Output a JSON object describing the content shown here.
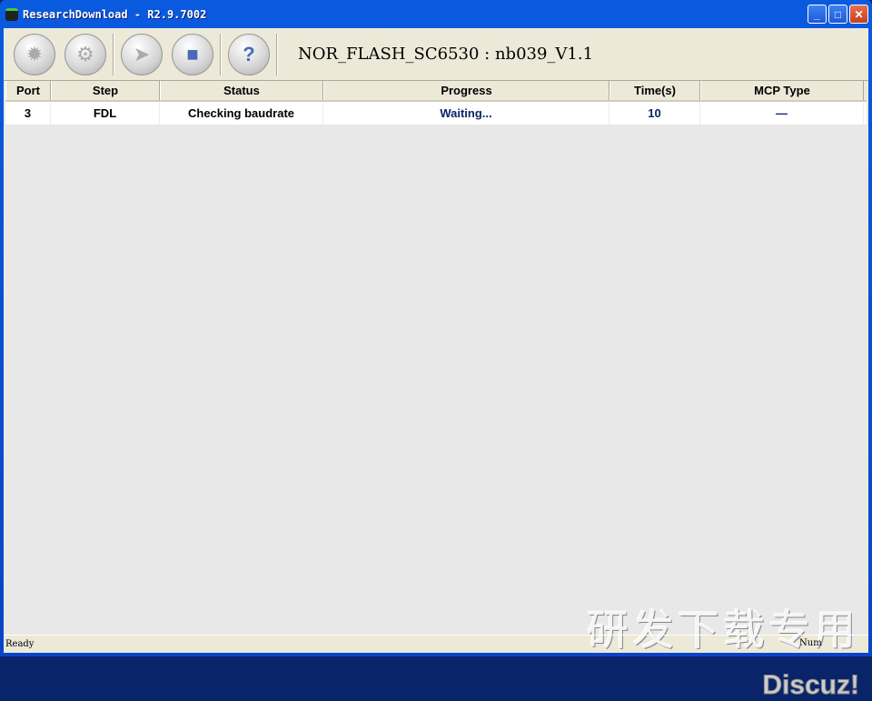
{
  "window": {
    "title": "ResearchDownload - R2.9.7002",
    "minimize": "_",
    "maximize": "□",
    "close": "✕"
  },
  "toolbar": {
    "buttons": [
      {
        "name": "load-packet",
        "icon": "gear-icon",
        "glyph": "✹"
      },
      {
        "name": "settings",
        "icon": "gears-icon",
        "glyph": "⚙"
      },
      {
        "name": "start",
        "icon": "play-icon",
        "glyph": "➤"
      },
      {
        "name": "stop",
        "icon": "stop-icon",
        "glyph": "■"
      },
      {
        "name": "help",
        "icon": "question-icon",
        "glyph": "?"
      }
    ],
    "project": "NOR_FLASH_SC6530 : nb039_V1.1"
  },
  "table": {
    "columns": [
      "Port",
      "Step",
      "Status",
      "Progress",
      "Time(s)",
      "MCP Type"
    ],
    "rows": [
      {
        "port": "3",
        "step": "FDL",
        "status": "Checking baudrate",
        "progress": "Waiting...",
        "time": "10",
        "mcp": "—"
      }
    ]
  },
  "watermark": {
    "text": "研发下载专用",
    "brand": "Discuz!"
  },
  "statusbar": {
    "text": "Ready",
    "num": "Num"
  }
}
